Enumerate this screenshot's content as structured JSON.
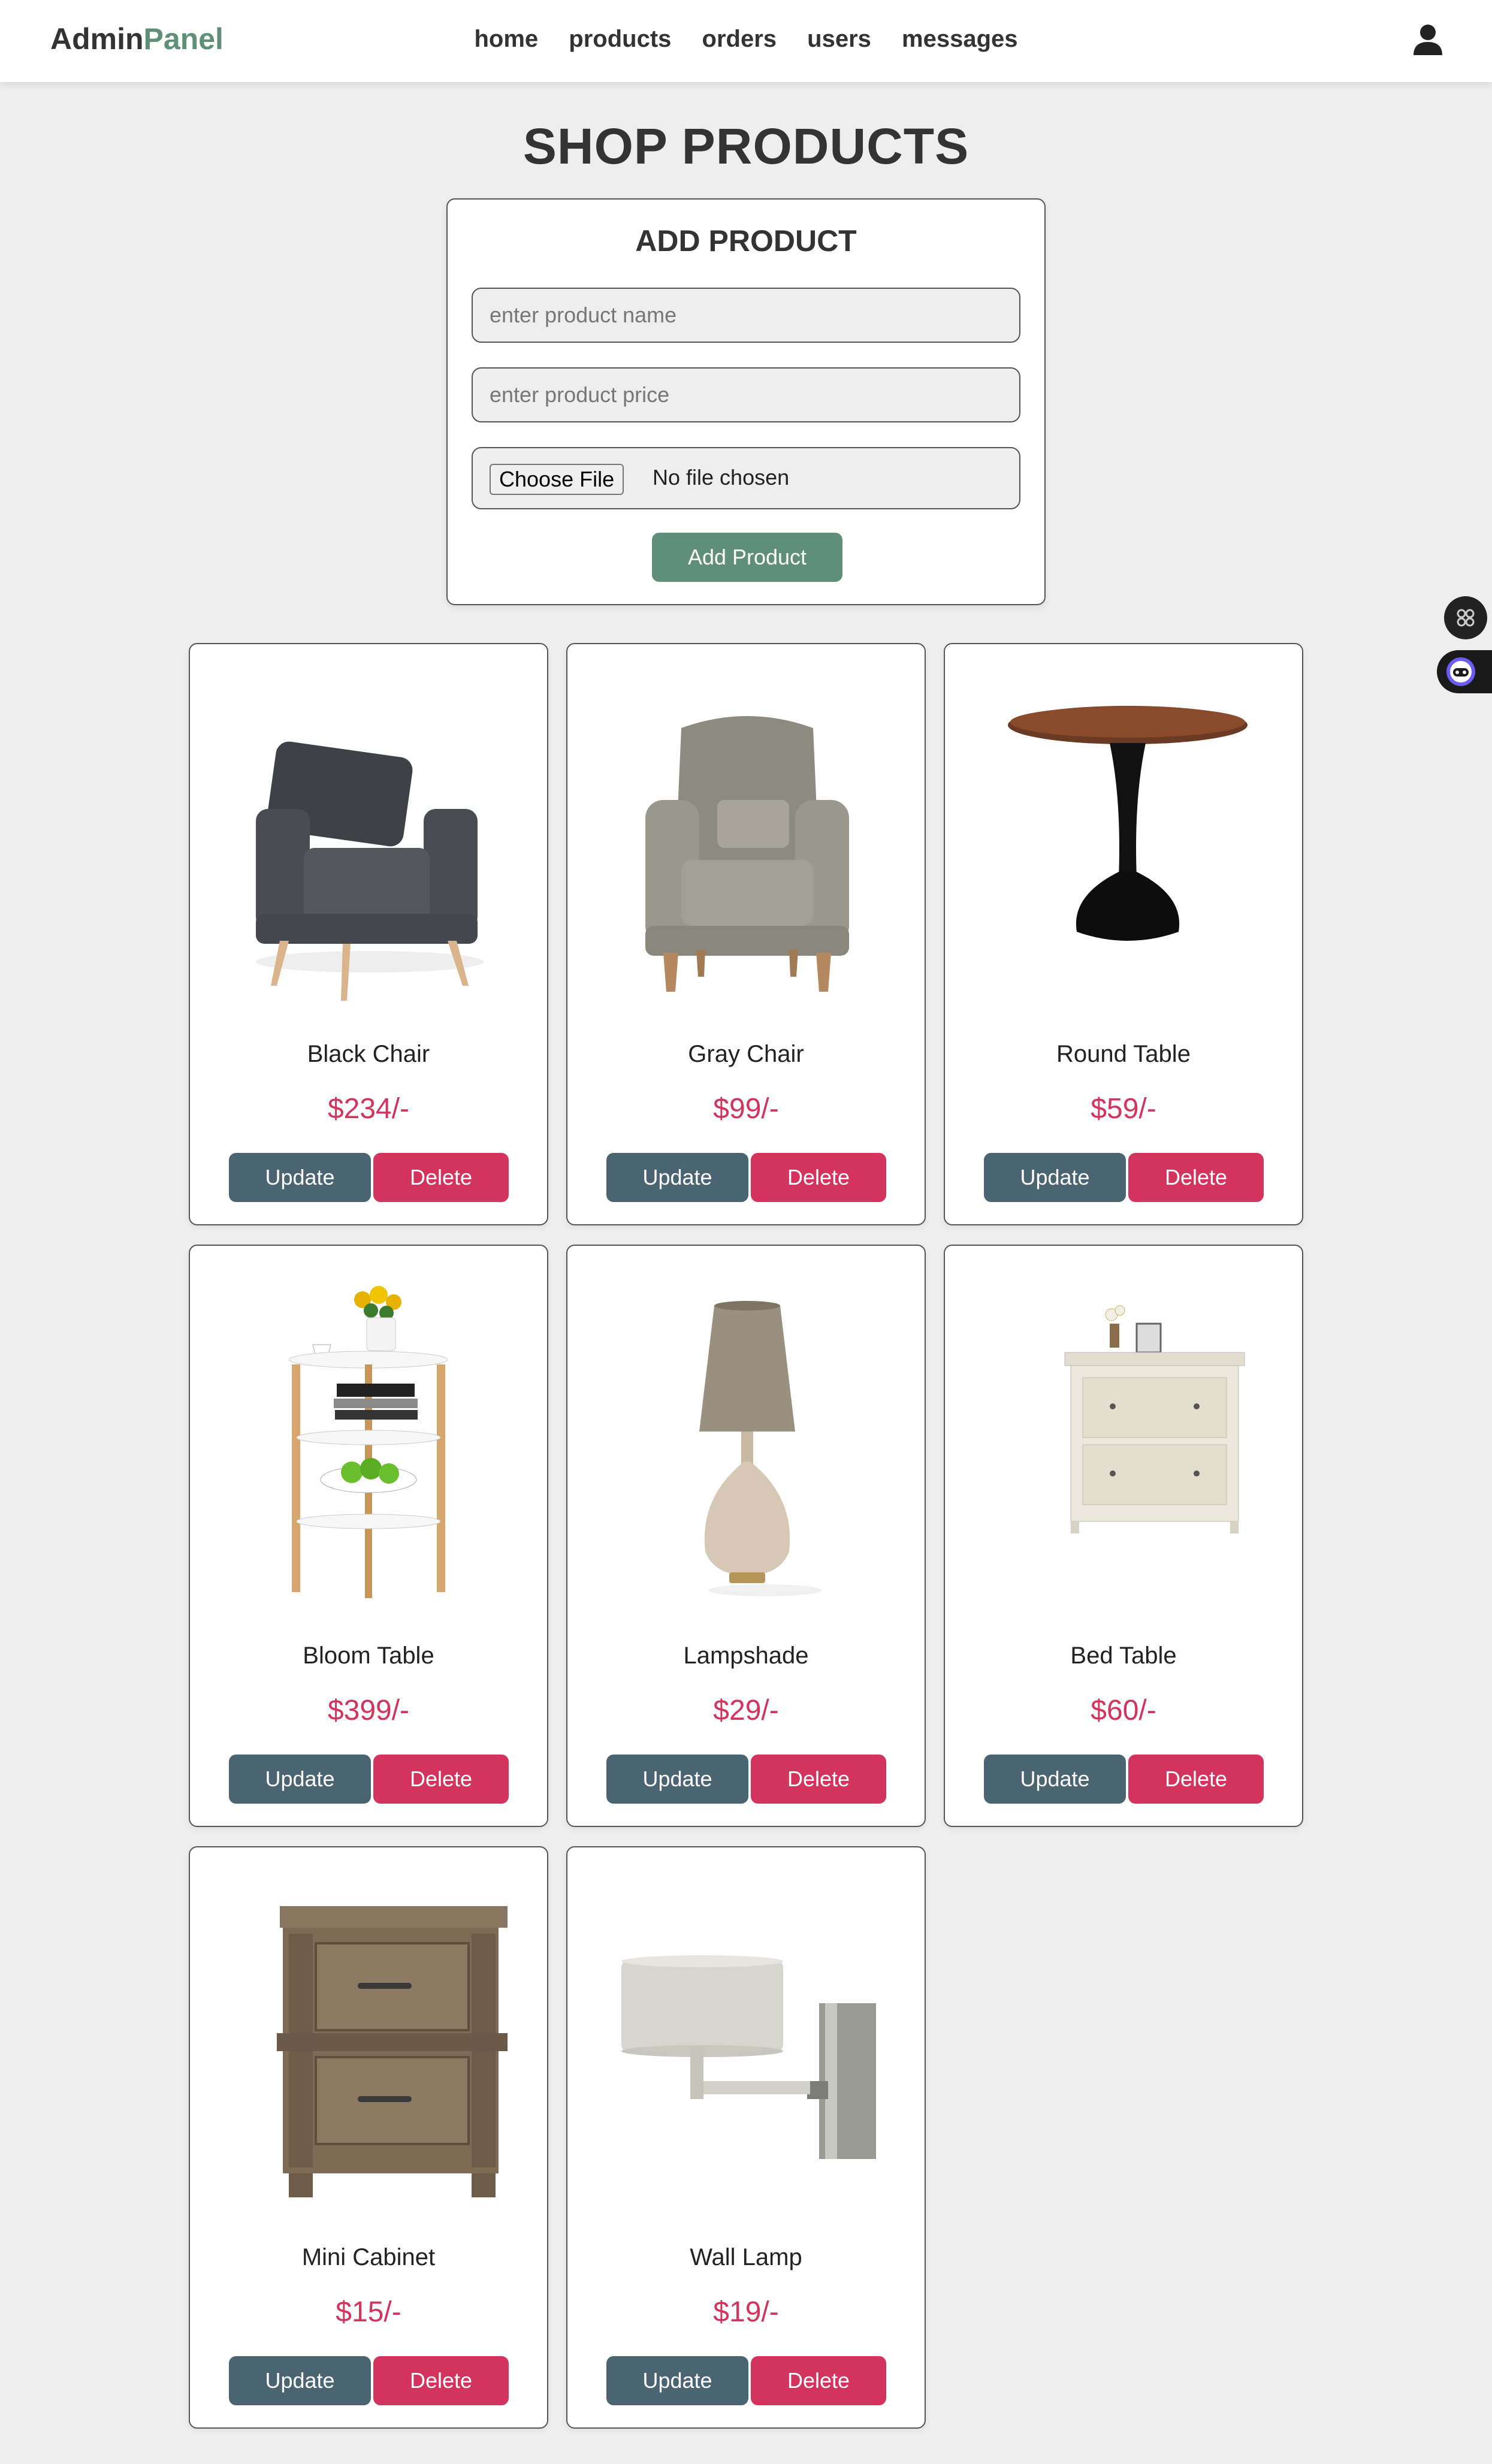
{
  "header": {
    "logo_main": "Admin",
    "logo_accent": "Panel",
    "nav": [
      "home",
      "products",
      "orders",
      "users",
      "messages"
    ]
  },
  "page_title": "SHOP PRODUCTS",
  "add_form": {
    "title": "ADD PRODUCT",
    "name_placeholder": "enter product name",
    "price_placeholder": "enter product price",
    "file_button": "Choose File",
    "file_status": "No file chosen",
    "submit_label": "Add Product"
  },
  "buttons": {
    "update": "Update",
    "delete": "Delete"
  },
  "products": [
    {
      "name": "Black Chair",
      "price": "$234/-",
      "icon": "armchair-dark"
    },
    {
      "name": "Gray Chair",
      "price": "$99/-",
      "icon": "armchair-gray"
    },
    {
      "name": "Round Table",
      "price": "$59/-",
      "icon": "round-table"
    },
    {
      "name": "Bloom Table",
      "price": "$399/-",
      "icon": "side-table-flowers"
    },
    {
      "name": "Lampshade",
      "price": "$29/-",
      "icon": "table-lamp"
    },
    {
      "name": "Bed Table",
      "price": "$60/-",
      "icon": "nightstand-white"
    },
    {
      "name": "Mini Cabinet",
      "price": "$15/-",
      "icon": "wooden-cabinet"
    },
    {
      "name": "Wall Lamp",
      "price": "$19/-",
      "icon": "wall-lamp"
    }
  ],
  "colors": {
    "accent": "#5f8f7a",
    "price": "#d2345d",
    "update": "#4b6472",
    "delete": "#d2345d"
  }
}
